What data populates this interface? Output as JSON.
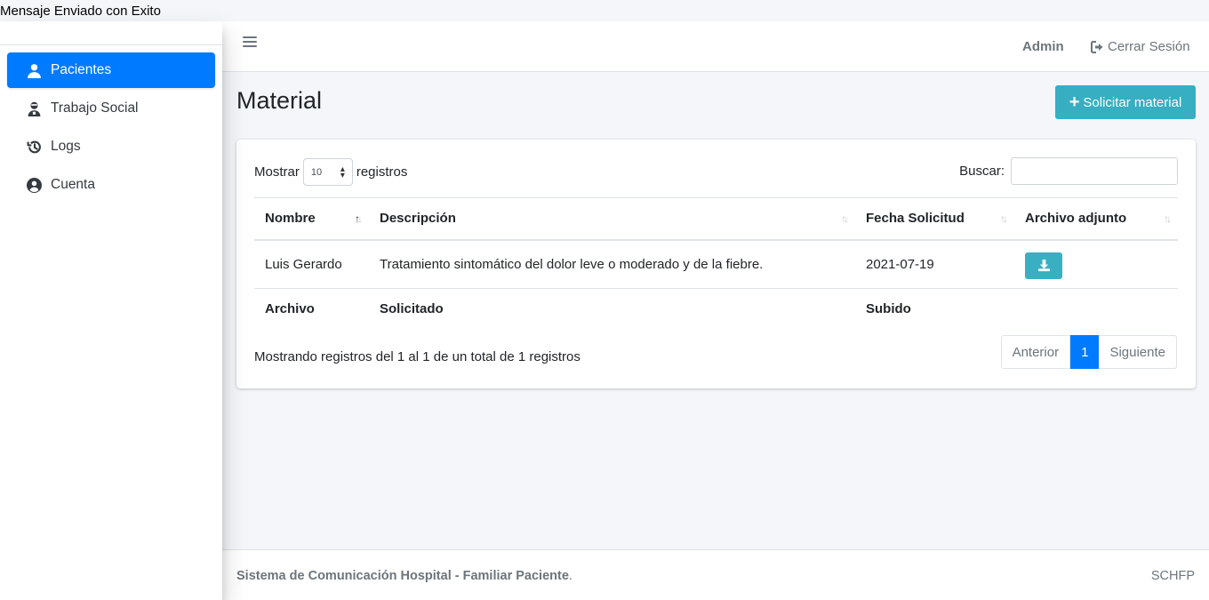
{
  "flash_message": "Mensaje Enviado con Exito",
  "sidebar": {
    "items": [
      {
        "label": "Pacientes",
        "icon": "user-icon",
        "active": true
      },
      {
        "label": "Trabajo Social",
        "icon": "user-doctor-icon",
        "active": false
      },
      {
        "label": "Logs",
        "icon": "history-icon",
        "active": false
      },
      {
        "label": "Cuenta",
        "icon": "user-circle-icon",
        "active": false
      }
    ]
  },
  "topbar": {
    "user": "Admin",
    "logout_label": "Cerrar Sesión"
  },
  "page": {
    "title": "Material",
    "request_button": "Solicitar material"
  },
  "table_controls": {
    "show_prefix": "Mostrar",
    "length_value": "10",
    "show_suffix": "registros",
    "search_label": "Buscar:",
    "search_value": ""
  },
  "table": {
    "columns": [
      "Nombre",
      "Descripción",
      "Fecha Solicitud",
      "Archivo adjunto"
    ],
    "rows": [
      {
        "nombre": "Luis Gerardo",
        "descripcion": "Tratamiento sintomático del dolor leve o moderado y de la fiebre.",
        "fecha": "2021-07-19",
        "archivo_icon": "download-icon"
      }
    ],
    "footer": [
      "Archivo",
      "Solicitado",
      "Subido",
      ""
    ]
  },
  "pagination": {
    "info": "Mostrando registros del 1 al 1 de un total de 1 registros",
    "previous": "Anterior",
    "current": "1",
    "next": "Siguiente"
  },
  "footer": {
    "app_name": "Sistema de Comunicación Hospital - Familiar Paciente",
    "suffix": ".",
    "abbr": "SCHFP"
  },
  "colors": {
    "primary": "#007bff",
    "info": "#17a2b8",
    "background": "#f4f6f9"
  }
}
